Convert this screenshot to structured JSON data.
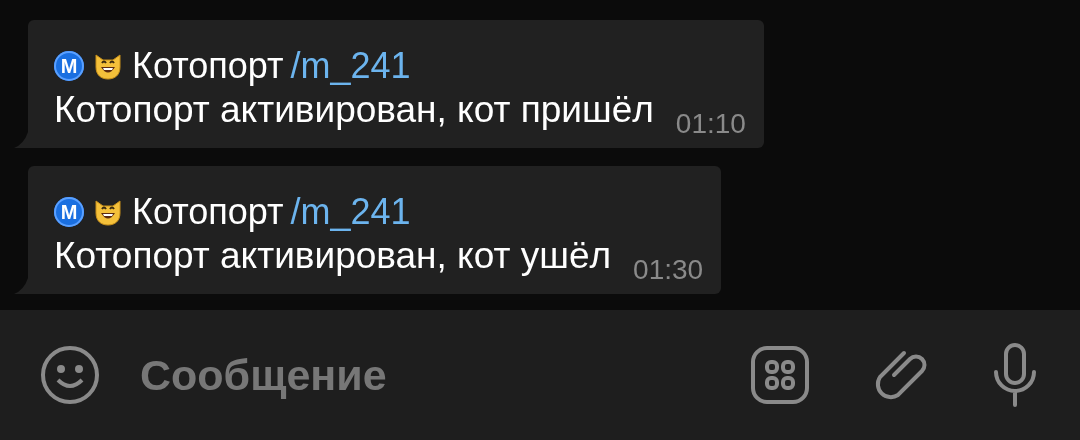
{
  "messages": [
    {
      "badge": "M",
      "sender": "Котопорт",
      "command": "/m_241",
      "text": "Котопорт активирован, кот пришёл",
      "time": "01:10"
    },
    {
      "badge": "M",
      "sender": "Котопорт",
      "command": "/m_241",
      "text": "Котопорт активирован, кот ушёл",
      "time": "01:30"
    }
  ],
  "composer": {
    "placeholder": "Сообщение"
  }
}
